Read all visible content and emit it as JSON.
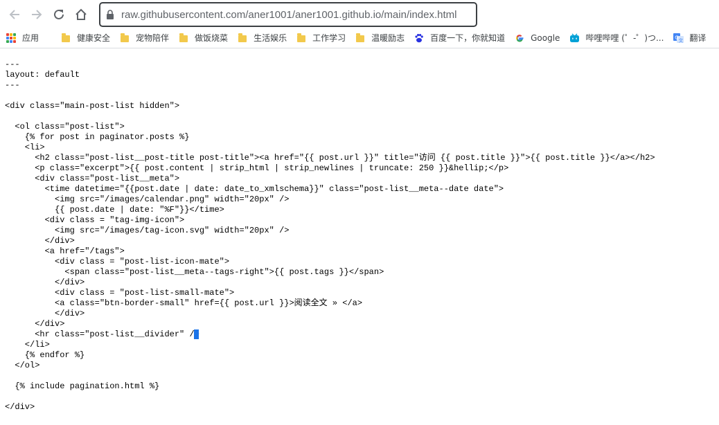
{
  "browser": {
    "url": "raw.githubusercontent.com/aner1001/aner1001.github.io/main/index.html",
    "nav": {
      "back_icon": "arrow-left-icon",
      "forward_icon": "arrow-right-icon",
      "reload_icon": "reload-icon",
      "home_icon": "home-icon",
      "lock_icon": "lock-icon"
    }
  },
  "bookmarks": [
    {
      "label": "应用",
      "icon": "apps-grid-icon"
    },
    {
      "label": "健康安全",
      "icon": "folder-icon"
    },
    {
      "label": "宠物陪伴",
      "icon": "folder-icon"
    },
    {
      "label": "做饭烧菜",
      "icon": "folder-icon"
    },
    {
      "label": "生活娱乐",
      "icon": "folder-icon"
    },
    {
      "label": "工作学习",
      "icon": "folder-icon"
    },
    {
      "label": "温暖励志",
      "icon": "folder-icon"
    },
    {
      "label": "百度一下，你就知道",
      "icon": "baidu-paw-icon"
    },
    {
      "label": "Google",
      "icon": "google-g-icon"
    },
    {
      "label": "哔哩哔哩 (゜-゜)つ...",
      "icon": "bilibili-tv-icon"
    },
    {
      "label": "翻译",
      "icon": "translate-icon"
    }
  ],
  "colors": {
    "folder": "#f2c94c",
    "caret": "#1a73e8",
    "text": "#000000"
  },
  "document": {
    "code": "---\nlayout: default\n---\n\n<div class=\"main-post-list hidden\">\n\n  <ol class=\"post-list\">\n    {% for post in paginator.posts %}\n    <li>\n      <h2 class=\"post-list__post-title post-title\"><a href=\"{{ post.url }}\" title=\"访问 {{ post.title }}\">{{ post.title }}</a></h2>\n      <p class=\"excerpt\">{{ post.content | strip_html | strip_newlines | truncate: 250 }}&hellip;</p>\n      <div class=\"post-list__meta\">\n        <time datetime=\"{{post.date | date: date_to_xmlschema}}\" class=\"post-list__meta--date date\">\n          <img src=\"/images/calendar.png\" width=\"20px\" />\n          {{ post.date | date: \"%F\"}}</time>\n        <div class = \"tag-img-icon\">\n          <img src=\"/images/tag-icon.svg\" width=\"20px\" />\n        </div>\n        <a href=\"/tags\">\n          <div class = \"post-list-icon-mate\">\n            <span class=\"post-list__meta--tags-right\">{{ post.tags }}</span>\n          </div>\n          <div class = \"post-list-small-mate\">\n          <a class=\"btn-border-small\" href={{ post.url }}>阅读全文 » </a>\n          </div>\n      </div>\n      <hr class=\"post-list__divider\" />\n    </li>\n    {% endfor %}\n  </ol>\n\n  {% include pagination.html %}\n\n</div>"
  }
}
